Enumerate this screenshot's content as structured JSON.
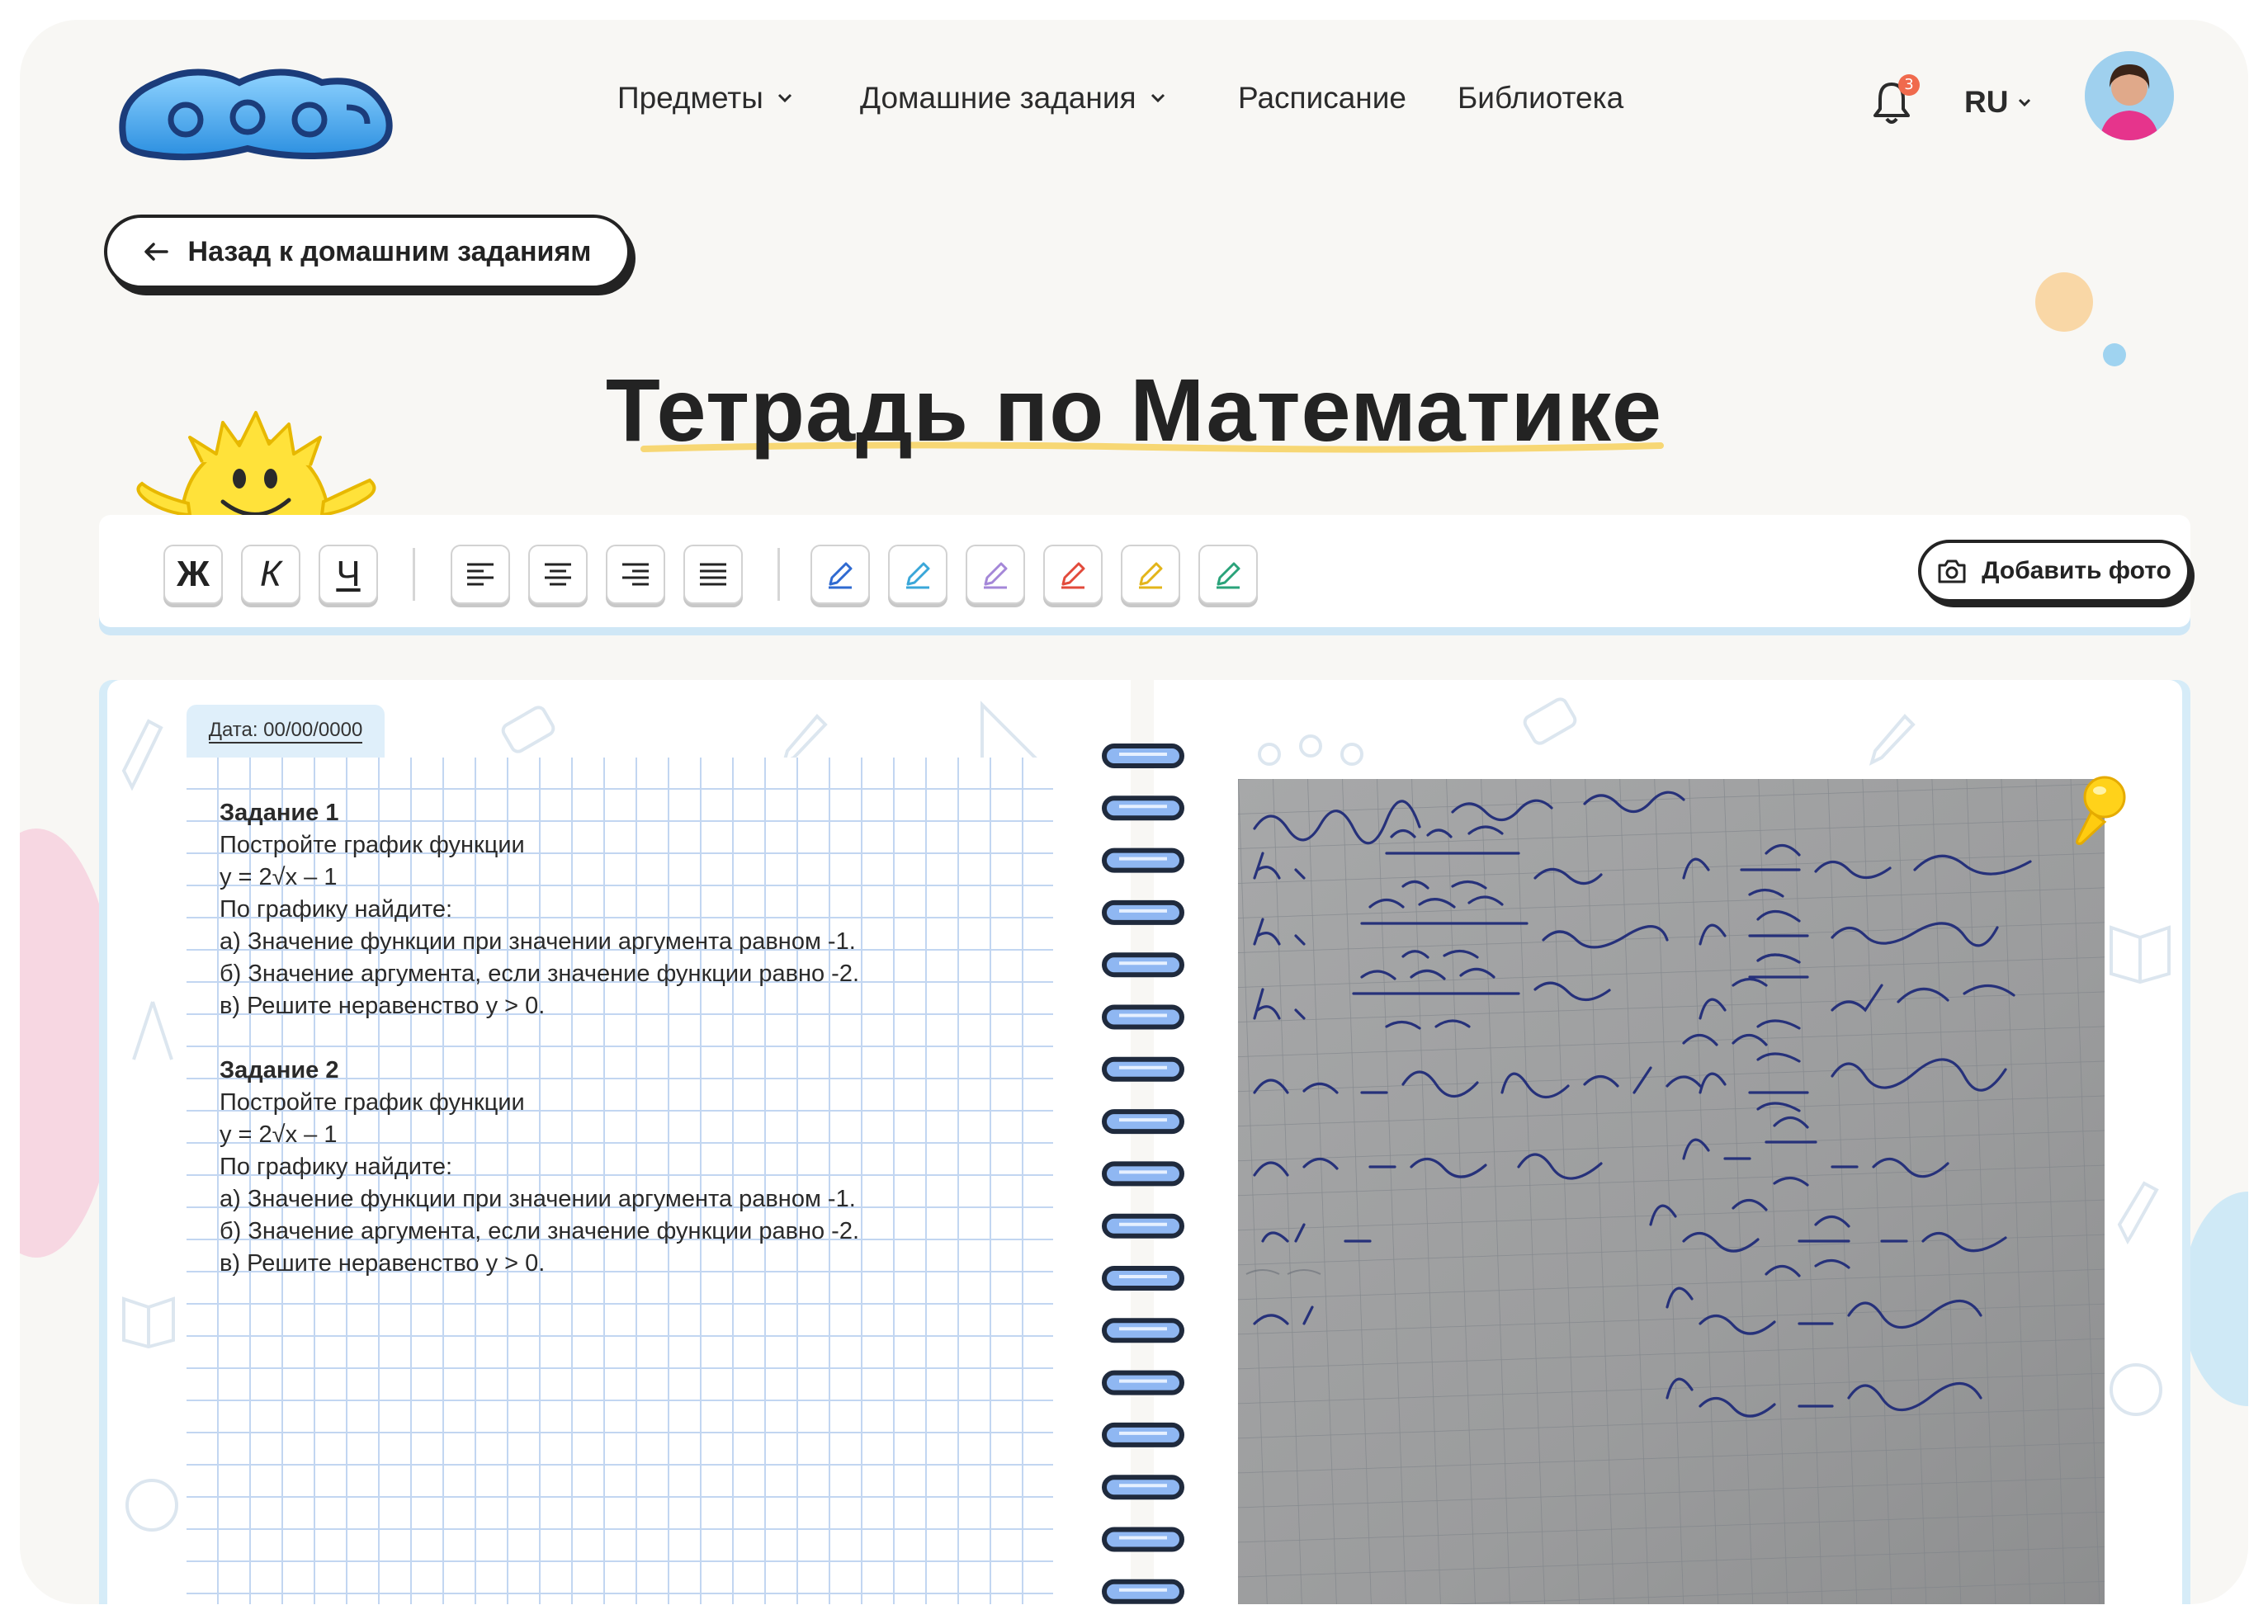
{
  "brand": {
    "logo_alt": "logo"
  },
  "nav": {
    "items": [
      {
        "label": "Предметы",
        "has_dropdown": true
      },
      {
        "label": "Домашние задания",
        "has_dropdown": true
      },
      {
        "label": "Расписание",
        "has_dropdown": false
      },
      {
        "label": "Библиотека",
        "has_dropdown": false
      }
    ],
    "notifications_count": "3",
    "language": "RU"
  },
  "back_button": {
    "label": "Назад к домашним заданиям"
  },
  "page_title": "Тетрадь по Математике",
  "toolbar": {
    "format_buttons": [
      "Ж",
      "К",
      "Ч"
    ],
    "align_buttons": [
      "align-left",
      "align-center",
      "align-right",
      "align-justify"
    ],
    "pen_colors": [
      "#2f6ad1",
      "#3aa7d9",
      "#a487d8",
      "#e24a3b",
      "#e3b51a",
      "#2aa37a"
    ],
    "add_photo_label": "Добавить фото"
  },
  "notebook": {
    "date_label": "Дата: 00/00/0000",
    "tasks": [
      {
        "title": "Задание 1",
        "lines": [
          "Постройте график функции",
          "y = 2√x – 1",
          "По графику найдите:",
          "а) Значение функции при значении аргумента равном -1.",
          "б) Значение аргумента, если значение функции равно -2.",
          "в) Решите неравенство y > 0."
        ]
      },
      {
        "title": "Задание 2",
        "lines": [
          "Постройте график функции",
          "y = 2√x – 1",
          "По графику найдите:",
          "а) Значение функции при значении аргумента равном -1.",
          "б) Значение аргумента, если значение функции равно -2.",
          "в) Решите неравенство y > 0."
        ]
      }
    ]
  },
  "colors": {
    "accent_underline": "#f7d774",
    "page_edge": "#d6ecf8",
    "ink": "#26317a"
  }
}
